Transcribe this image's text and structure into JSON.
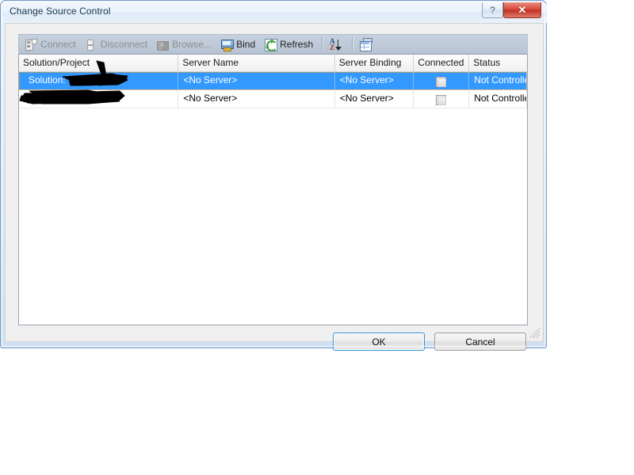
{
  "window": {
    "title": "Change Source Control",
    "help_glyph": "?",
    "close_glyph": "✕"
  },
  "toolbar": {
    "items": [
      {
        "label": "Connect",
        "icon": "connect-icon",
        "enabled": false
      },
      {
        "label": "Disconnect",
        "icon": "disconnect-icon",
        "enabled": false
      },
      {
        "label": "Browse...",
        "icon": "browse-icon",
        "enabled": false
      },
      {
        "label": "Bind",
        "icon": "bind-icon",
        "enabled": true
      },
      {
        "label": "Refresh",
        "icon": "refresh-icon",
        "enabled": true
      }
    ],
    "sort_icon": "sort-az-icon",
    "sort_letter_a": "A",
    "sort_letter_z": "Z",
    "columns_icon": "column-options-icon"
  },
  "list": {
    "columns": [
      "Solution/Project",
      "Server Name",
      "Server Binding",
      "Connected",
      "Status"
    ],
    "rows": [
      {
        "solution_project": "Solution:",
        "server_name": "<No Server>",
        "server_binding": "<No Server>",
        "connected": false,
        "status": "Not Controlle",
        "selected": true,
        "redacted": true
      },
      {
        "solution_project": "",
        "server_name": "<No Server>",
        "server_binding": "<No Server>",
        "connected": false,
        "status": "Not Controlle",
        "selected": false,
        "redacted": true
      }
    ]
  },
  "buttons": {
    "ok": "OK",
    "cancel": "Cancel"
  },
  "colors": {
    "selection": "#3399ff",
    "toolbar_bg": "#bfcad9",
    "dialog_bg": "#f0f0f0",
    "close_button": "#c13325",
    "default_button_focus": "#2c94d8"
  }
}
